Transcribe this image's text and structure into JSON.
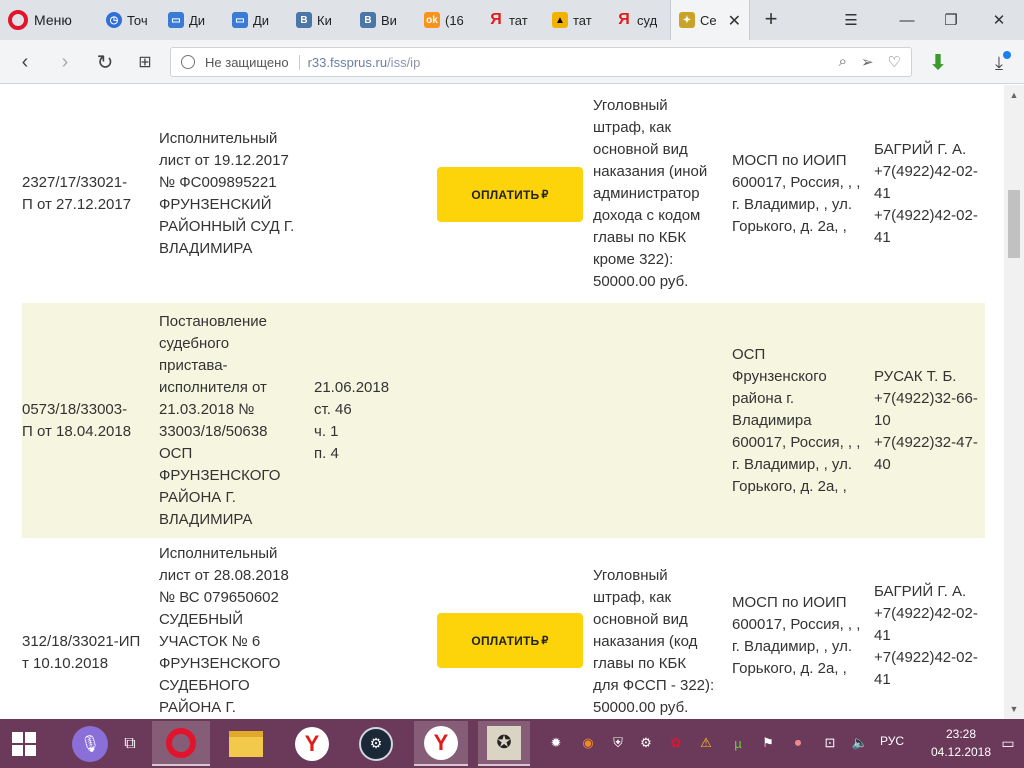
{
  "browser": {
    "menu_label": "Меню",
    "tabs": [
      {
        "label": "Точ",
        "icon": "clock-icon",
        "color": "#2f6fd6"
      },
      {
        "label": "Ди",
        "icon": "chat-icon",
        "color": "#3a7bd5"
      },
      {
        "label": "Ди",
        "icon": "chat-icon",
        "color": "#3a7bd5"
      },
      {
        "label": "Ки",
        "icon": "vk-icon",
        "color": "#4a76a8"
      },
      {
        "label": "Ви",
        "icon": "vk-icon",
        "color": "#4a76a8"
      },
      {
        "label": "(16",
        "icon": "odnoklassniki-icon",
        "color": "#f7931e"
      },
      {
        "label": "тат",
        "icon": "yandex-icon",
        "color": "#e21b1b"
      },
      {
        "label": "тат",
        "icon": "image-icon",
        "color": "#f2b300"
      },
      {
        "label": "суд",
        "icon": "yandex-icon",
        "color": "#e21b1b"
      },
      {
        "label": "Се",
        "icon": "emblem-icon",
        "color": "#c9a227"
      }
    ],
    "close_glyph": "✕",
    "new_tab_glyph": "+",
    "address": {
      "security_label": "Не защищено",
      "host": "r33.fssprus.ru",
      "path": "/iss/ip"
    }
  },
  "rows": [
    {
      "case": "2327/17/33021-\nП от 27.12.2017",
      "document": "Исполнительный\nлист от 19.12.2017\n№ ФС009895221\nФРУНЗЕНСКИЙ\nРАЙОННЫЙ СУД Г.\nВЛАДИМИРА",
      "article": "",
      "pay_label": "ОПЛАТИТЬ",
      "pay_symbol": "₽",
      "subject": "Уголовный\nштраф, как\nосновной вид\nнаказания (иной\nадминистратор\nдохода с кодом\nглавы по КБК\nкроме 322):\n50000.00 руб.",
      "department": "МОСП по ИОИП\n600017, Россия, , ,\nг. Владимир, , ул.\nГорького, д. 2а, ,",
      "bailiff": "БАГРИЙ Г. А.\n+7(4922)42-02-\n41\n+7(4922)42-02-\n41"
    },
    {
      "case": "0573/18/33003-\nП от 18.04.2018",
      "document": "Постановление\nсудебного\nпристава-\nисполнителя от\n21.03.2018 №\n33003/18/50638\nОСП\nФРУНЗЕНСКОГО\nРАЙОНА Г.\nВЛАДИМИРА",
      "article": "21.06.2018\nст. 46\nч. 1\nп. 4",
      "pay_label": "",
      "subject": "",
      "department": "ОСП\nФрунзенского\nрайона г.\nВладимира\n600017, Россия, , ,\nг. Владимир, , ул.\nГорького, д. 2а, ,",
      "bailiff": "РУСАК Т. Б.\n+7(4922)32-66-\n10\n+7(4922)32-47-\n40"
    },
    {
      "case": "312/18/33021-ИП\nт 10.10.2018",
      "document": "Исполнительный\nлист от 28.08.2018\n№ ВС 079650602\nСУДЕБНЫЙ\nУЧАСТОК № 6\nФРУНЗЕНСКОГО\nСУДЕБНОГО\nРАЙОНА Г.",
      "article": "",
      "pay_label": "ОПЛАТИТЬ",
      "pay_symbol": "₽",
      "subject": "Уголовный\nштраф, как\nосновной вид\nнаказания (код\nглавы по КБК\nдля ФССП - 322):\n50000.00 руб.",
      "department": "МОСП по ИОИП\n600017, Россия, , ,\nг. Владимир, , ул.\nГорького, д. 2а, ,",
      "bailiff": "БАГРИЙ Г. А.\n+7(4922)42-02-\n41\n+7(4922)42-02-\n41"
    }
  ],
  "taskbar": {
    "language": "РУС",
    "time": "23:28",
    "date": "04.12.2018"
  },
  "colors": {
    "pay_button": "#fdd409",
    "alt_row": "#f6f5e0",
    "taskbar": "#6b3a5a"
  }
}
